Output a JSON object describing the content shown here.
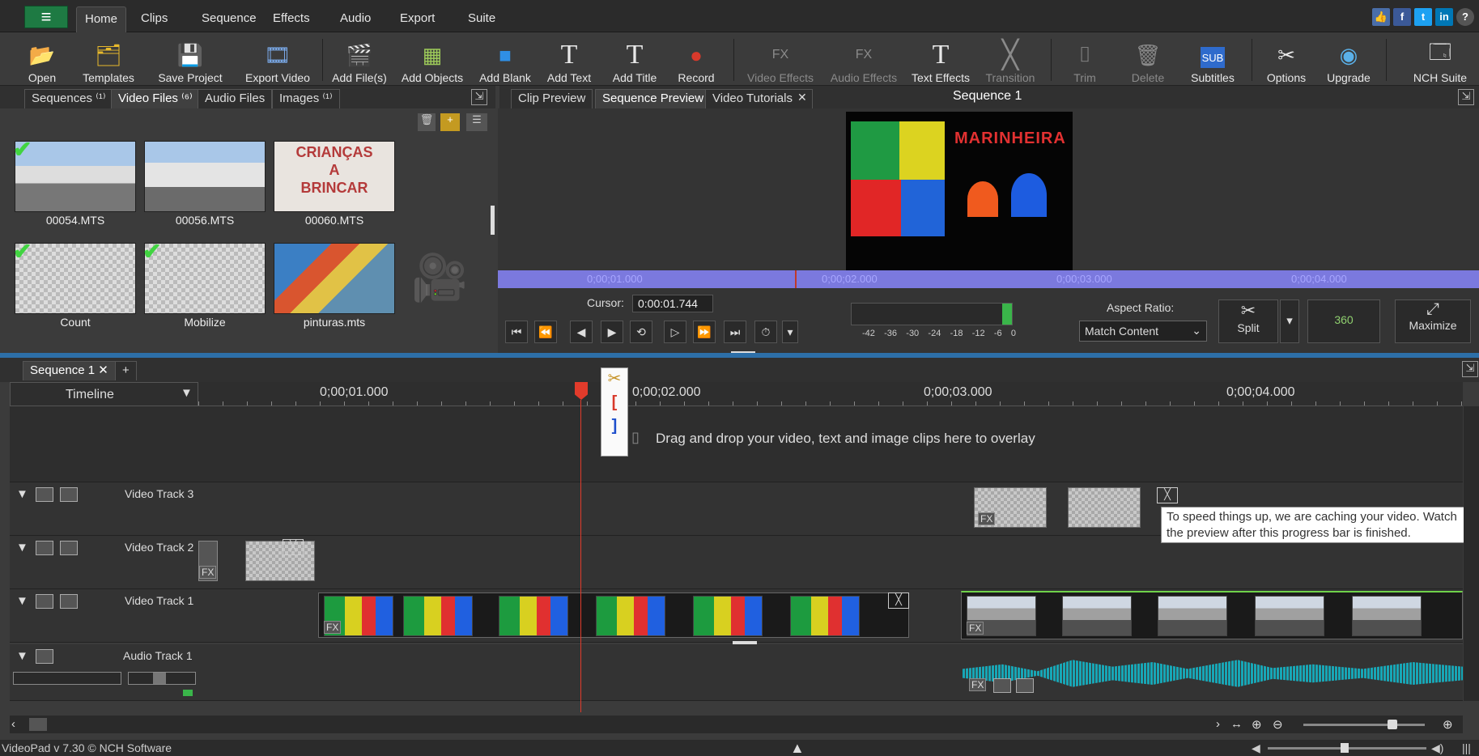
{
  "menu": {
    "tabs": [
      "Home",
      "Clips",
      "Sequence",
      "Effects",
      "Audio",
      "Export",
      "Suite"
    ],
    "active": "Home"
  },
  "toolbar": {
    "open": "Open",
    "templates": "Templates",
    "save_project": "Save Project",
    "export_video": "Export Video",
    "add_files": "Add File(s)",
    "add_objects": "Add Objects",
    "add_blank": "Add Blank",
    "add_text": "Add Text",
    "add_title": "Add Title",
    "record": "Record",
    "video_effects": "Video Effects",
    "audio_effects": "Audio Effects",
    "text_effects": "Text Effects",
    "transition": "Transition",
    "trim": "Trim",
    "delete": "Delete",
    "subtitles": "Subtitles",
    "options": "Options",
    "upgrade": "Upgrade",
    "nch_suite": "NCH Suite"
  },
  "bin": {
    "tabs": [
      "Sequences ⁽¹⁾",
      "Video Files ⁽⁶⁾",
      "Audio Files",
      "Images ⁽¹⁾"
    ],
    "files": [
      "00054.MTS",
      "00056.MTS",
      "00060.MTS",
      "Count",
      "Mobilize",
      "pinturas.mts"
    ],
    "sign_text": "CRIANÇAS\nA\nBRINCAR"
  },
  "preview": {
    "tabs": [
      "Clip Preview",
      "Sequence Preview",
      "Video Tutorials"
    ],
    "title": "Sequence 1",
    "logo_text": "MARINHEIRA",
    "ruler": [
      "0;00;01.000",
      "0;00;02.000",
      "0;00;03.000",
      "0;00;04.000"
    ],
    "cursor_label": "Cursor:",
    "cursor_value": "0:00:01.744",
    "meter_labels": [
      "-42",
      "-36",
      "-30",
      "-24",
      "-18",
      "-12",
      "-6",
      "0"
    ],
    "aspect_label": "Aspect Ratio:",
    "aspect_value": "Match Content",
    "split": "Split",
    "three_sixty": "360",
    "maximize": "Maximize"
  },
  "timeline": {
    "tab": "Sequence 1",
    "label": "Timeline",
    "ruler": [
      "0;00;01.000",
      "0;00;02.000",
      "0;00;03.000",
      "0;00;04.000"
    ],
    "overlay_hint": "Drag and drop your video, text and image clips here to overlay",
    "tracks": [
      "Video Track 3",
      "Video Track 2",
      "Video Track 1",
      "Audio Track 1"
    ],
    "tooltip": "To speed things up, we are caching your video. Watch the preview after this progress bar is finished."
  },
  "status": {
    "version": "VideoPad v 7.30 © NCH Software"
  }
}
